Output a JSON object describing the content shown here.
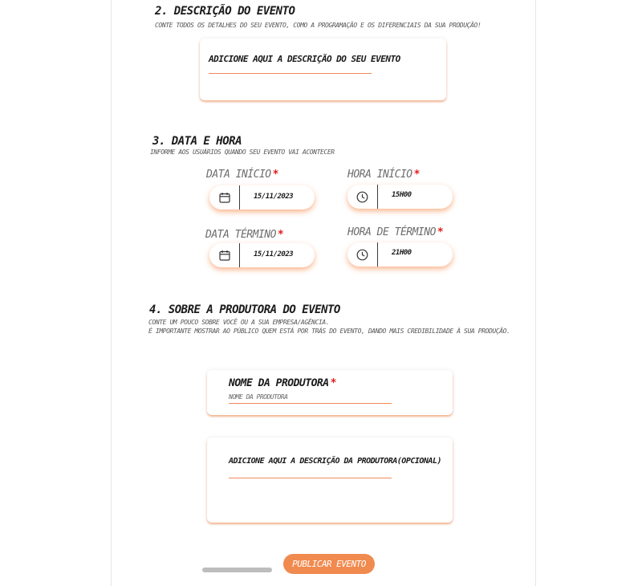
{
  "section2": {
    "title": "2. Descrição do evento",
    "subtitle": "Conte todos os detalhes do seu evento, como a programação e os diferenciais da sua produção!",
    "description_label": "Adicione aqui a descrição do seu evento"
  },
  "section3": {
    "title": "3. Data e hora",
    "subtitle": "Informe aos usuários quando seu evento vai acontecer",
    "start_date": {
      "label": "Data início",
      "required": "*",
      "value": "15/11/2023",
      "icon": "calendar-icon"
    },
    "start_time": {
      "label": "Hora início",
      "required": "*",
      "value": "15h00",
      "icon": "clock-icon"
    },
    "end_date": {
      "label": "Data término",
      "required": "*",
      "value": "15/11/2023",
      "icon": "calendar-icon"
    },
    "end_time": {
      "label": "Hora de término",
      "required": "*",
      "value": "21h00",
      "icon": "clock-icon"
    }
  },
  "section4": {
    "title": "4. Sobre a produtora do evento",
    "subtitle_line1": "Conte um pouco sobre você ou a sua empresa/agência.",
    "subtitle_line2": "É importante mostrar ao público quem está por trás do evento, dando mais credibilidade à sua produção.",
    "producer_name": {
      "label": "Nome da produtora",
      "required": "*",
      "placeholder": "Nome da produtora"
    },
    "producer_description_label": "Adicione aqui a descrição da produtora(opcional)"
  },
  "publish_button": "Publicar evento",
  "colors": {
    "accent": "#f18a4f",
    "required": "#e31b1b"
  }
}
